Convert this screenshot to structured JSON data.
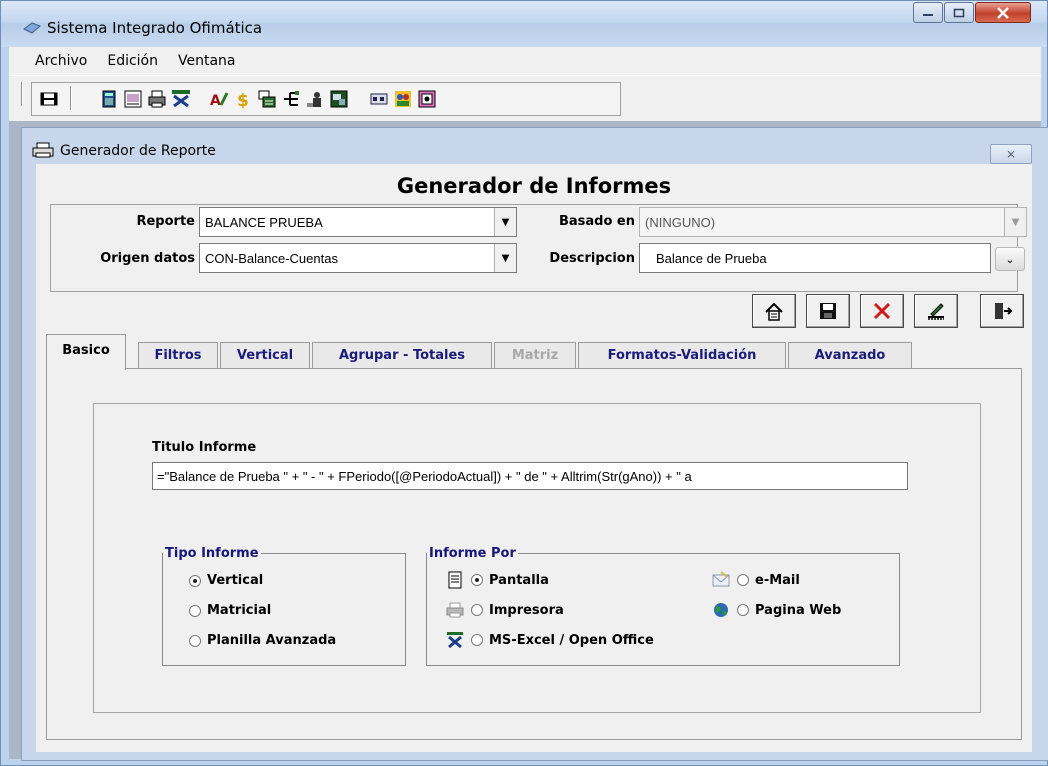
{
  "app": {
    "title": "Sistema Integrado Ofimática",
    "menu": [
      "Archivo",
      "Edición",
      "Ventana"
    ]
  },
  "toolbar": {
    "icons": [
      "exit-icon",
      "calculator-icon",
      "document-icon",
      "printer-icon",
      "excel-icon",
      "text-icon",
      "dollar-icon",
      "form-icon",
      "tree-icon",
      "user-icon",
      "chart-icon",
      "window-icon",
      "people-icon",
      "report-icon"
    ]
  },
  "child": {
    "title": "Generador de Reporte",
    "close_glyph": "⨯"
  },
  "form": {
    "heading": "Generador de Informes",
    "reporte_label": "Reporte",
    "reporte_value": "BALANCE PRUEBA",
    "basado_label": "Basado en",
    "basado_value": "(NINGUNO)",
    "origen_label": "Origen datos",
    "origen_value": "CON-Balance-Cuentas",
    "descripcion_label": "Descripcion",
    "descripcion_value": "Balance de Prueba"
  },
  "tabs": [
    "Basico",
    "Filtros",
    "Vertical",
    "Agrupar - Totales",
    "Matriz",
    "Formatos-Validación",
    "Avanzado"
  ],
  "basico": {
    "titulo_label": "Titulo Informe",
    "titulo_value": "=\"Balance de Prueba \"  +  \" - \" + FPeriodo([@PeriodoActual]) + \" de \" + Alltrim(Str(gAno)) + \" a",
    "tipo_legend": "Tipo Informe",
    "tipo_options": [
      "Vertical",
      "Matricial",
      "Planilla Avanzada"
    ],
    "tipo_selected": "Vertical",
    "por_legend": "Informe Por",
    "por_options": [
      "Pantalla",
      "Impresora",
      "MS-Excel / Open Office",
      "e-Mail",
      "Pagina Web"
    ],
    "por_selected": "Pantalla"
  },
  "colors": {
    "tab_text": "#1b1b7a",
    "legend_text": "#15157a",
    "window_frame": "#c7d6ea"
  }
}
